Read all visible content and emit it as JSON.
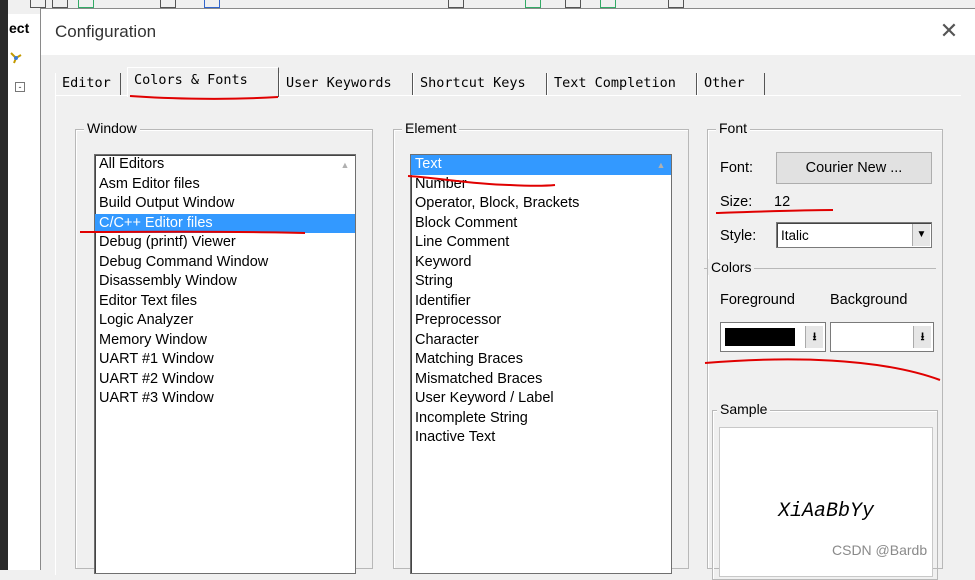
{
  "background": {
    "left_label": "ect",
    "tree_node": "-"
  },
  "dialog": {
    "title": "Configuration",
    "close_glyph": "✕"
  },
  "tabs": [
    {
      "label": "Editor",
      "active": false
    },
    {
      "label": "Colors & Fonts",
      "active": true
    },
    {
      "label": "User Keywords",
      "active": false
    },
    {
      "label": "Shortcut Keys",
      "active": false
    },
    {
      "label": "Text Completion",
      "active": false
    },
    {
      "label": "Other",
      "active": false
    }
  ],
  "window_group": {
    "label": "Window",
    "items": [
      "All Editors",
      "Asm Editor files",
      "Build Output Window",
      "C/C++ Editor files",
      "Debug (printf) Viewer",
      "Debug Command Window",
      "Disassembly Window",
      "Editor Text files",
      "Logic Analyzer",
      "Memory Window",
      "UART #1 Window",
      "UART #2 Window",
      "UART #3 Window"
    ],
    "selected": "C/C++ Editor files"
  },
  "element_group": {
    "label": "Element",
    "items": [
      "Text",
      "Number",
      "Operator, Block, Brackets",
      "Block Comment",
      "Line Comment",
      "Keyword",
      "String",
      "Identifier",
      "Preprocessor",
      "Character",
      "Matching Braces",
      "Mismatched Braces",
      "User Keyword / Label",
      "Incomplete String",
      "Inactive Text"
    ],
    "selected": "Text"
  },
  "font_group": {
    "label": "Font",
    "font_label": "Font:",
    "font_button": "Courier New ...",
    "size_label": "Size:",
    "size_value": "12",
    "style_label": "Style:",
    "style_value": "Italic"
  },
  "colors_group": {
    "label": "Colors",
    "foreground_label": "Foreground",
    "background_label": "Background",
    "foreground_color": "#000000",
    "background_color": "#ffffff",
    "arrow_glyph": "⭳"
  },
  "sample_group": {
    "label": "Sample",
    "text": "XiAaBbYy"
  },
  "watermark": "CSDN @Bardb",
  "colors": {
    "selection": "#3399ff",
    "annotation_red": "#e00000"
  }
}
